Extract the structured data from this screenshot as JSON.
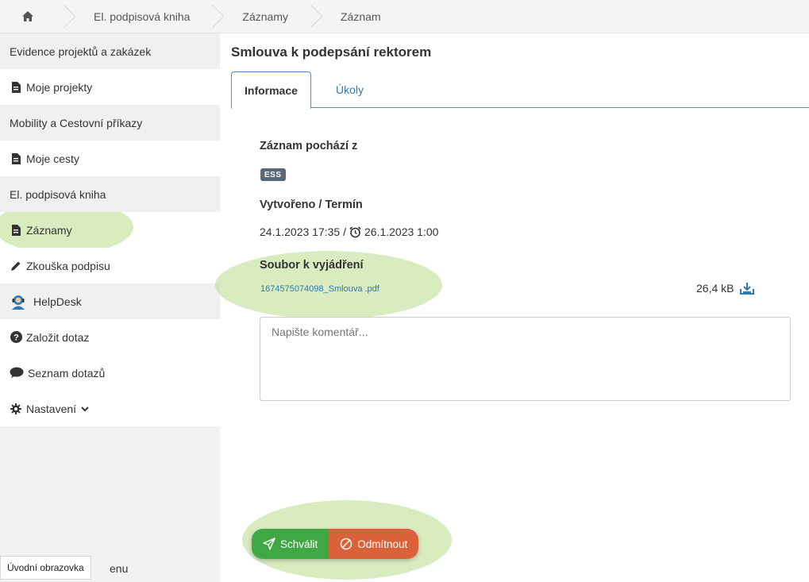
{
  "breadcrumb": {
    "items": [
      "El. podpisová kniha",
      "Záznamy",
      "Záznam"
    ]
  },
  "sidebar": {
    "items": [
      {
        "label": "Evidence projektů a zakázek",
        "type": "section"
      },
      {
        "label": "Moje projekty",
        "icon": "file-icon"
      },
      {
        "label": "Mobility a Cestovní příkazy",
        "type": "section"
      },
      {
        "label": "Moje cesty",
        "icon": "file-icon"
      },
      {
        "label": "El. podpisová kniha",
        "type": "section"
      },
      {
        "label": "Záznamy",
        "icon": "file-icon"
      },
      {
        "label": "Zkouška podpisu",
        "icon": "pencil-icon"
      },
      {
        "label": "HelpDesk",
        "icon": "helpdesk-icon",
        "type": "section"
      },
      {
        "label": "Založit dotaz",
        "icon": "question-icon"
      },
      {
        "label": "Seznam dotazů",
        "icon": "comment-icon"
      },
      {
        "label": "Nastavení",
        "icon": "gear-icon"
      }
    ],
    "tooltip": "Úvodní obrazovka",
    "bottom_text": "enu"
  },
  "main": {
    "title": "Smlouva k podepsání rektorem",
    "tabs": [
      {
        "label": "Informace",
        "active": true
      },
      {
        "label": "Úkoly",
        "active": false
      }
    ],
    "source_label": "Záznam pochází z",
    "source_badge": "ESS",
    "created_label": "Vytvořeno / Termín",
    "created_value": "24.1.2023 17:35 /",
    "deadline_value": "26.1.2023 1:00",
    "file_label": "Soubor k vyjádření",
    "file_name": "1674575074098_Smlouva .pdf",
    "file_size": "26,4 kB",
    "comment_placeholder": "Napište komentář...",
    "approve_label": "Schválit",
    "reject_label": "Odmítnout"
  },
  "colors": {
    "accent": "#2a7ab8",
    "approve": "#3fa845",
    "reject": "#d9623a",
    "highlight": "#badd8c"
  }
}
